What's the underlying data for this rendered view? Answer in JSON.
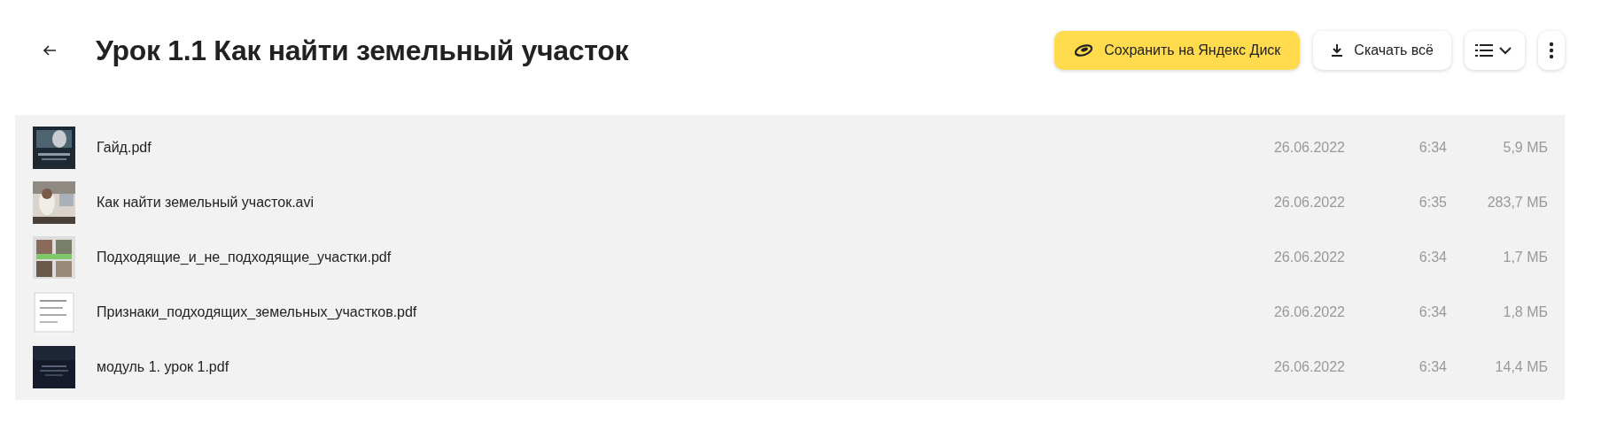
{
  "header": {
    "title": "Урок 1.1 Как найти земельный участок",
    "buttons": [
      {
        "kind": "save",
        "label": "Сохранить на Яндекс Диск"
      },
      {
        "kind": "download",
        "label": "Скачать всё"
      },
      {
        "kind": "view"
      },
      {
        "kind": "more"
      }
    ]
  },
  "files": [
    {
      "name": "Гайд.pdf",
      "date": "26.06.2022",
      "time": "6:34",
      "size": "5,9 МБ"
    },
    {
      "name": "Как найти земельный участок.avi",
      "date": "26.06.2022",
      "time": "6:35",
      "size": "283,7 МБ"
    },
    {
      "name": "Подходящие_и_не_подходящие_участки.pdf",
      "date": "26.06.2022",
      "time": "6:34",
      "size": "1,7 МБ"
    },
    {
      "name": "Признаки_подходящих_земельных_участков.pdf",
      "date": "26.06.2022",
      "time": "6:34",
      "size": "1,8 МБ"
    },
    {
      "name": "модуль 1. урок 1.pdf",
      "date": "26.06.2022",
      "time": "6:34",
      "size": "14,4 МБ"
    }
  ]
}
